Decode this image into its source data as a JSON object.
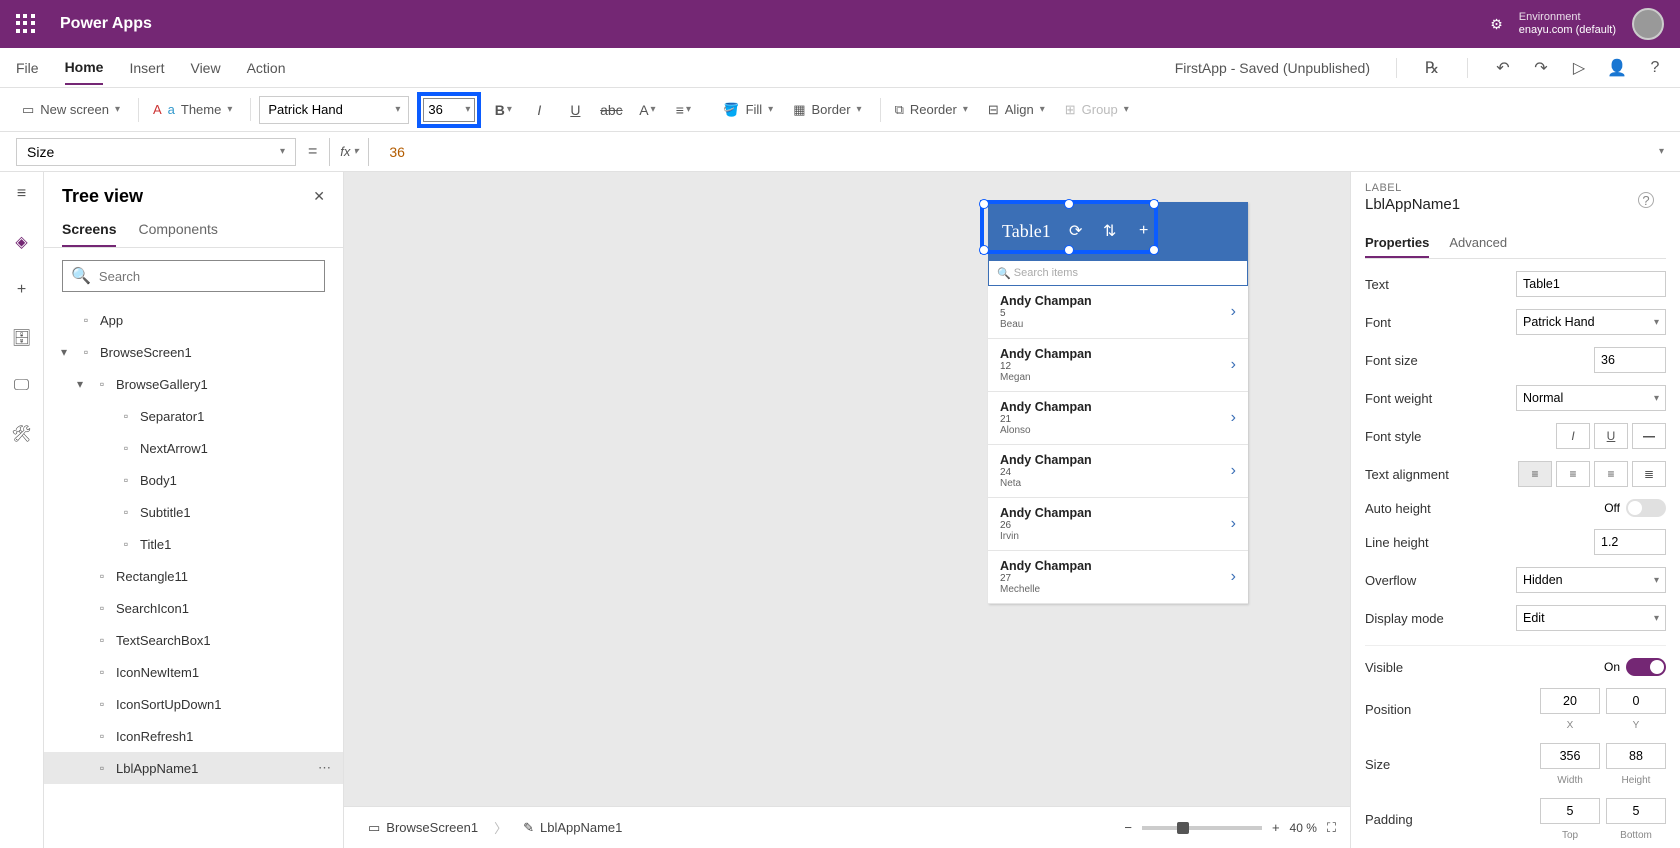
{
  "header": {
    "brand": "Power Apps",
    "env_label": "Environment",
    "env_name": "enayu.com (default)"
  },
  "menu": {
    "items": [
      "File",
      "Home",
      "Insert",
      "View",
      "Action"
    ],
    "active": "Home",
    "app_status": "FirstApp - Saved (Unpublished)"
  },
  "toolbar": {
    "new_screen": "New screen",
    "theme": "Theme",
    "font": "Patrick Hand",
    "size": "36",
    "fill": "Fill",
    "border": "Border",
    "reorder": "Reorder",
    "align": "Align",
    "group": "Group"
  },
  "formula": {
    "property": "Size",
    "value": "36"
  },
  "tree": {
    "title": "Tree view",
    "tabs": [
      "Screens",
      "Components"
    ],
    "active_tab": "Screens",
    "search_ph": "Search",
    "items": [
      {
        "label": "App",
        "indent": 0,
        "icon": "app"
      },
      {
        "label": "BrowseScreen1",
        "indent": 0,
        "icon": "screen",
        "expand": true
      },
      {
        "label": "BrowseGallery1",
        "indent": 1,
        "icon": "gallery",
        "expand": true
      },
      {
        "label": "Separator1",
        "indent": 2,
        "icon": "sep"
      },
      {
        "label": "NextArrow1",
        "indent": 2,
        "icon": "ctrl"
      },
      {
        "label": "Body1",
        "indent": 2,
        "icon": "txt"
      },
      {
        "label": "Subtitle1",
        "indent": 2,
        "icon": "txt"
      },
      {
        "label": "Title1",
        "indent": 2,
        "icon": "txt"
      },
      {
        "label": "Rectangle11",
        "indent": 1,
        "icon": "rect"
      },
      {
        "label": "SearchIcon1",
        "indent": 1,
        "icon": "ctrl"
      },
      {
        "label": "TextSearchBox1",
        "indent": 1,
        "icon": "input"
      },
      {
        "label": "IconNewItem1",
        "indent": 1,
        "icon": "ctrl"
      },
      {
        "label": "IconSortUpDown1",
        "indent": 1,
        "icon": "ctrl"
      },
      {
        "label": "IconRefresh1",
        "indent": 1,
        "icon": "ctrl"
      },
      {
        "label": "LblAppName1",
        "indent": 1,
        "icon": "txt",
        "selected": true
      }
    ]
  },
  "canvas": {
    "label_text": "Table1",
    "search_ph": "Search items",
    "items": [
      {
        "title": "Andy Champan",
        "sub": "5",
        "sub2": "Beau"
      },
      {
        "title": "Andy Champan",
        "sub": "12",
        "sub2": "Megan"
      },
      {
        "title": "Andy Champan",
        "sub": "21",
        "sub2": "Alonso"
      },
      {
        "title": "Andy Champan",
        "sub": "24",
        "sub2": "Neta"
      },
      {
        "title": "Andy Champan",
        "sub": "26",
        "sub2": "Irvin"
      },
      {
        "title": "Andy Champan",
        "sub": "27",
        "sub2": "Mechelle"
      }
    ],
    "crumb1": "BrowseScreen1",
    "crumb2": "LblAppName1",
    "zoom": "40  %"
  },
  "props": {
    "type": "LABEL",
    "name": "LblAppName1",
    "tabs": [
      "Properties",
      "Advanced"
    ],
    "active_tab": "Properties",
    "labels": {
      "text": "Text",
      "font": "Font",
      "font_size": "Font size",
      "font_weight": "Font weight",
      "font_style": "Font style",
      "text_align": "Text alignment",
      "auto_height": "Auto height",
      "line_height": "Line height",
      "overflow": "Overflow",
      "display_mode": "Display mode",
      "visible": "Visible",
      "position": "Position",
      "size": "Size",
      "padding": "Padding",
      "x": "X",
      "y": "Y",
      "width": "Width",
      "height": "Height",
      "top": "Top",
      "bottom": "Bottom",
      "off": "Off",
      "on": "On"
    },
    "values": {
      "text": "Table1",
      "font": "Patrick Hand",
      "font_size": "36",
      "font_weight": "Normal",
      "line_height": "1.2",
      "overflow": "Hidden",
      "display_mode": "Edit",
      "pos_x": "20",
      "pos_y": "0",
      "size_w": "356",
      "size_h": "88",
      "pad_top": "5",
      "pad_bottom": "5"
    }
  }
}
